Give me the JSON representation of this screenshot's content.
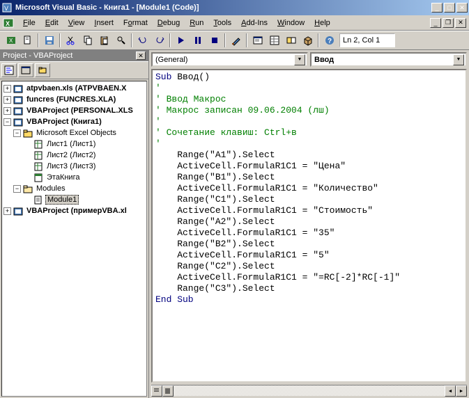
{
  "window": {
    "title": "Microsoft Visual Basic - Книга1 - [Module1 (Code)]"
  },
  "menu": {
    "file": "File",
    "edit": "Edit",
    "view": "View",
    "insert": "Insert",
    "format": "Format",
    "debug": "Debug",
    "run": "Run",
    "tools": "Tools",
    "addins": "Add-Ins",
    "window": "Window",
    "help": "Help"
  },
  "toolbar": {
    "status": "Ln 2, Col 1"
  },
  "project_panel": {
    "title": "Project - VBAProject",
    "tree": {
      "n0": "atpvbaen.xls (ATPVBAEN.X",
      "n1": "funcres (FUNCRES.XLA)",
      "n2": "VBAProject (PERSONAL.XLS",
      "n3": "VBAProject (Книга1)",
      "n3_0": "Microsoft Excel Objects",
      "n3_0_0": "Лист1 (Лист1)",
      "n3_0_1": "Лист2 (Лист2)",
      "n3_0_2": "Лист3 (Лист3)",
      "n3_0_3": "ЭтаКнига",
      "n3_1": "Modules",
      "n3_1_0": "Module1",
      "n4": "VBAProject (примерVBA.xl"
    }
  },
  "code_panel": {
    "object_combo": "(General)",
    "proc_combo": "Ввод",
    "code": {
      "l0": "Sub Ввод()",
      "l1": "'",
      "l2": "' Ввод Макрос",
      "l3": "' Макрос записан 09.06.2004 (лш)",
      "l4": "'",
      "l5": "' Сочетание клавиш: Ctrl+в",
      "l6": "'",
      "l7": "    Range(\"A1\").Select",
      "l8": "    ActiveCell.FormulaR1C1 = \"Цена\"",
      "l9": "    Range(\"B1\").Select",
      "l10": "    ActiveCell.FormulaR1C1 = \"Количество\"",
      "l11": "    Range(\"C1\").Select",
      "l12": "    ActiveCell.FormulaR1C1 = \"Стоимость\"",
      "l13": "    Range(\"A2\").Select",
      "l14": "    ActiveCell.FormulaR1C1 = \"35\"",
      "l15": "    Range(\"B2\").Select",
      "l16": "    ActiveCell.FormulaR1C1 = \"5\"",
      "l17": "    Range(\"C2\").Select",
      "l18": "    ActiveCell.FormulaR1C1 = \"=RC[-2]*RC[-1]\"",
      "l19": "    Range(\"C3\").Select",
      "l20": "End Sub"
    }
  }
}
